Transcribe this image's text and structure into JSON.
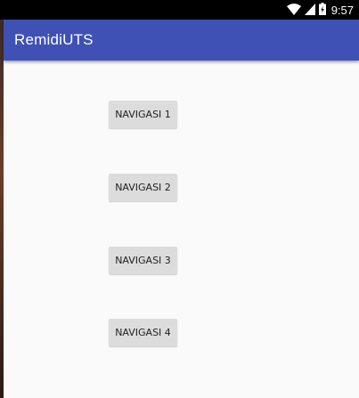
{
  "status_bar": {
    "time": "9:57",
    "icons": [
      "wifi-icon",
      "signal-icon",
      "battery-icon"
    ]
  },
  "app_bar": {
    "title": "RemidiUTS",
    "color": "#3f51b5"
  },
  "buttons": [
    {
      "label": "NAVIGASI 1"
    },
    {
      "label": "NAVIGASI 2"
    },
    {
      "label": "NAVIGASI 3"
    },
    {
      "label": "NAVIGASI 4"
    }
  ],
  "colors": {
    "background": "#fafafa",
    "button": "#dcdcdc"
  }
}
